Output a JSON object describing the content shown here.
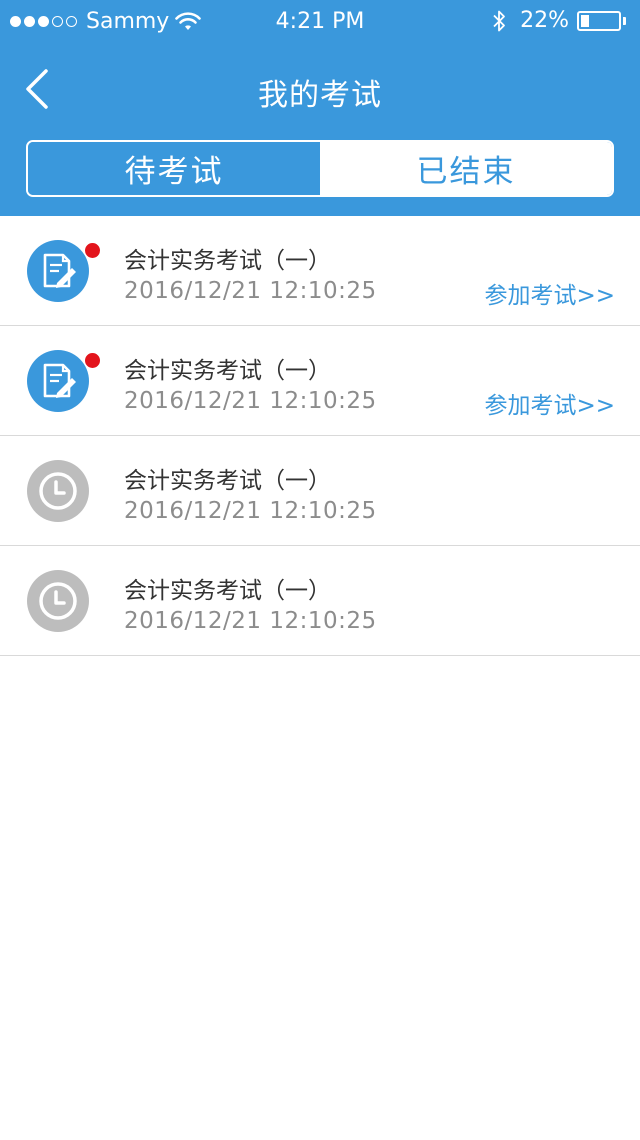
{
  "status_bar": {
    "carrier": "Sammy",
    "time": "4:21 PM",
    "battery": "22%",
    "battery_level": 0.22,
    "signal_dots": 3
  },
  "nav": {
    "title": "我的考试"
  },
  "tabs": [
    {
      "label": "待考试",
      "active": true
    },
    {
      "label": "已结束",
      "active": false
    }
  ],
  "exams": [
    {
      "title": "会计实务考试（一）",
      "datetime": "2016/12/21  12:10:25",
      "action": "参加考试>>",
      "icon": "exam-edit-icon",
      "unread": true
    },
    {
      "title": "会计实务考试（一）",
      "datetime": "2016/12/21  12:10:25",
      "action": "参加考试>>",
      "icon": "exam-edit-icon",
      "unread": true
    },
    {
      "title": "会计实务考试（一）",
      "datetime": "2016/12/21  12:10:25",
      "icon": "clock-icon",
      "unread": false
    },
    {
      "title": "会计实务考试（一）",
      "datetime": "2016/12/21  12:10:25",
      "icon": "clock-icon",
      "unread": false
    }
  ],
  "colors": {
    "primary": "#3a98dc",
    "badge": "#e3141c",
    "muted_icon": "#bdbdbd",
    "date_text": "#8c8c8c"
  }
}
